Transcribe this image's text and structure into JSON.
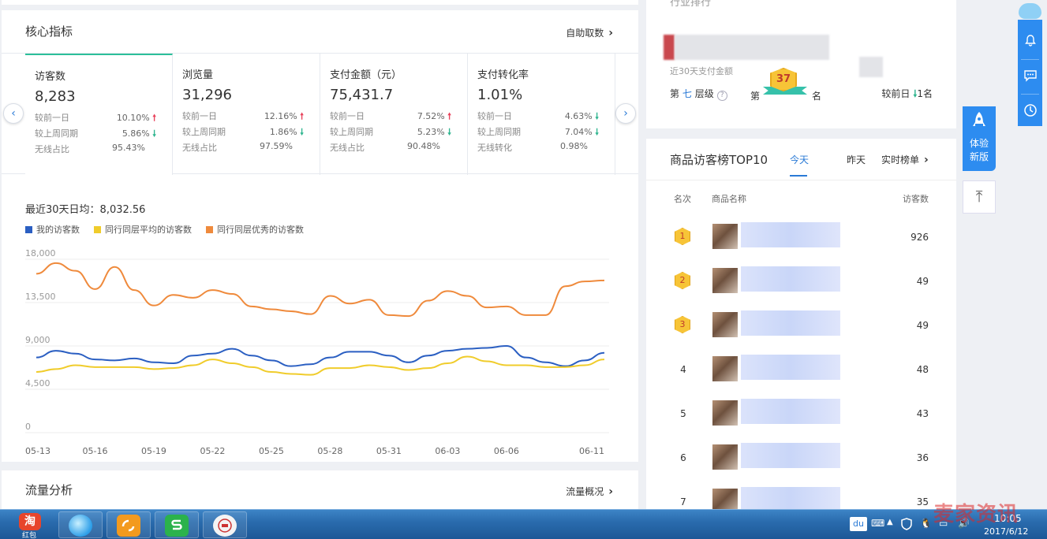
{
  "core": {
    "title": "核心指标",
    "self_fetch": "自助取数",
    "metrics": [
      {
        "label": "访客数",
        "value": "8,283",
        "rows": [
          {
            "label": "较前一日",
            "value": "10.10%",
            "trend": "up"
          },
          {
            "label": "较上周同期",
            "value": "5.86%",
            "trend": "down"
          },
          {
            "label": "无线占比",
            "value": "95.43%",
            "trend": ""
          }
        ]
      },
      {
        "label": "浏览量",
        "value": "31,296",
        "rows": [
          {
            "label": "较前一日",
            "value": "12.16%",
            "trend": "up"
          },
          {
            "label": "较上周同期",
            "value": "1.86%",
            "trend": "down"
          },
          {
            "label": "无线占比",
            "value": "97.59%",
            "trend": ""
          }
        ]
      },
      {
        "label": "支付金额（元）",
        "value": "75,431.7",
        "rows": [
          {
            "label": "较前一日",
            "value": "7.52%",
            "trend": "up"
          },
          {
            "label": "较上周同期",
            "value": "5.23%",
            "trend": "down"
          },
          {
            "label": "无线占比",
            "value": "90.48%",
            "trend": ""
          }
        ]
      },
      {
        "label": "支付转化率",
        "value": "1.01%",
        "rows": [
          {
            "label": "较前一日",
            "value": "4.63%",
            "trend": "down"
          },
          {
            "label": "较上周同期",
            "value": "7.04%",
            "trend": "down"
          },
          {
            "label": "无线转化",
            "value": "0.98%",
            "trend": ""
          }
        ]
      }
    ],
    "avg_text": "最近30天日均：8,032.56",
    "legend": [
      {
        "name": "我的访客数",
        "color": "#2b5fc2"
      },
      {
        "name": "同行同层平均的访客数",
        "color": "#f0cc2b"
      },
      {
        "name": "同行同层优秀的访客数",
        "color": "#ef8a3c"
      }
    ]
  },
  "chart_data": {
    "type": "line",
    "x": [
      "05-13",
      "05-14",
      "05-15",
      "05-16",
      "05-17",
      "05-18",
      "05-19",
      "05-20",
      "05-21",
      "05-22",
      "05-23",
      "05-24",
      "05-25",
      "05-26",
      "05-27",
      "05-28",
      "05-29",
      "05-30",
      "05-31",
      "06-01",
      "06-02",
      "06-03",
      "06-04",
      "06-05",
      "06-06",
      "06-07",
      "06-08",
      "06-09",
      "06-10",
      "06-11"
    ],
    "xticks": [
      "05-13",
      "05-16",
      "05-19",
      "05-22",
      "05-25",
      "05-28",
      "05-31",
      "06-03",
      "06-06",
      "06-11"
    ],
    "yticks": [
      "0",
      "4,500",
      "9,000",
      "13,500",
      "18,000"
    ],
    "ylim": [
      0,
      18000
    ],
    "series": [
      {
        "name": "我的访客数",
        "color": "#2b5fc2",
        "values": [
          7800,
          8500,
          8200,
          7600,
          7500,
          7700,
          7300,
          7200,
          8000,
          8200,
          8700,
          8000,
          7500,
          6900,
          7100,
          7800,
          8400,
          8400,
          8000,
          7300,
          8000,
          8500,
          8700,
          8800,
          9000,
          7800,
          7300,
          6900,
          7500,
          8283
        ]
      },
      {
        "name": "同行同层平均的访客数",
        "color": "#f0cc2b",
        "values": [
          6300,
          6600,
          7000,
          6800,
          6800,
          6800,
          6600,
          6700,
          7000,
          7600,
          7200,
          6800,
          6300,
          6100,
          6000,
          6700,
          6700,
          7000,
          6800,
          6500,
          6700,
          7200,
          7900,
          7400,
          7000,
          7000,
          6800,
          6800,
          7000,
          7600
        ]
      },
      {
        "name": "同行同层优秀的访客数",
        "color": "#ef8a3c",
        "values": [
          16500,
          17600,
          16800,
          14900,
          17200,
          14800,
          13200,
          14300,
          14000,
          14800,
          14400,
          13100,
          12800,
          12600,
          12300,
          14200,
          13400,
          13800,
          12200,
          12100,
          13700,
          14700,
          14200,
          13000,
          13100,
          12200,
          12200,
          15200,
          15700,
          15800
        ]
      }
    ]
  },
  "traffic": {
    "title": "流量分析",
    "link": "流量概况"
  },
  "rank": {
    "head_cut": "行业排行",
    "sub": "近30天支付金额",
    "level_prefix": "第",
    "level_value": "七",
    "level_suffix": "层级",
    "rank_di": "第",
    "rank_number": "37",
    "rank_ming": "名",
    "prev_label": "较前日",
    "prev_value": "1名"
  },
  "top10": {
    "title": "商品访客榜TOP10",
    "tabs": [
      "今天",
      "昨天"
    ],
    "realtime": "实时榜单",
    "headers": {
      "rank": "名次",
      "name": "商品名称",
      "visitors": "访客数"
    },
    "rows": [
      {
        "rank": "1",
        "visitors": "926"
      },
      {
        "rank": "2",
        "visitors": "49"
      },
      {
        "rank": "3",
        "visitors": "49"
      },
      {
        "rank": "4",
        "visitors": "48"
      },
      {
        "rank": "5",
        "visitors": "43"
      },
      {
        "rank": "6",
        "visitors": "36"
      },
      {
        "rank": "7",
        "visitors": "35"
      }
    ]
  },
  "side": {
    "trial_line1": "体验",
    "trial_line2": "新版"
  },
  "taskbar": {
    "app1_label": "淘",
    "app1_sub": "红包",
    "time": "10:05",
    "date": "2017/6/12",
    "du": "du"
  },
  "watermark": "麦家资讯"
}
